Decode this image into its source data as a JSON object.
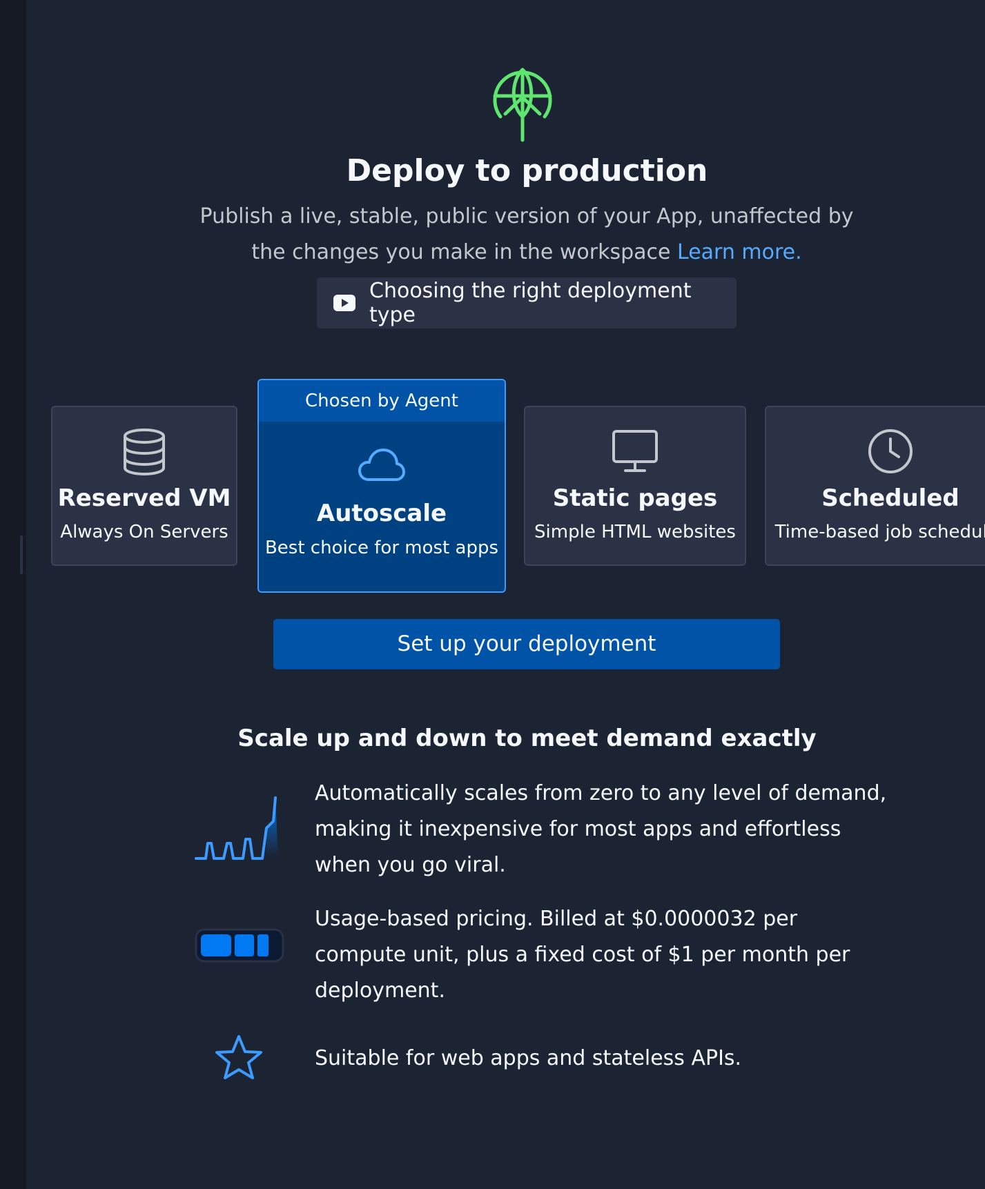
{
  "header": {
    "title": "Deploy to production",
    "subtitle": "Publish a live, stable, public version of your App, unaffected by the changes you make in the workspace",
    "learn_more": "Learn more.",
    "video_label": "Choosing the right deployment type"
  },
  "deployment_types": [
    {
      "name": "Reserved VM",
      "description": "Always On Servers",
      "icon": "database-icon"
    },
    {
      "name": "Autoscale",
      "description": "Best choice for most apps",
      "icon": "cloud-icon",
      "tag": "Chosen by Agent",
      "selected": true
    },
    {
      "name": "Static pages",
      "description": "Simple HTML websites",
      "icon": "monitor-icon"
    },
    {
      "name": "Scheduled",
      "description": "Time-based job scheduler",
      "icon": "clock-icon"
    }
  ],
  "actions": {
    "setup_label": "Set up your deployment"
  },
  "details": {
    "title": "Scale up and down to meet demand exactly",
    "features": [
      {
        "icon": "scaling-graph-icon",
        "text": "Automatically scales from zero to any level of demand, making it inexpensive for most apps and effortless when you go viral."
      },
      {
        "icon": "usage-meter-icon",
        "text": "Usage-based pricing. Billed at $0.0000032 per compute unit, plus a fixed cost of $1 per month per deployment."
      },
      {
        "icon": "star-icon",
        "text": "Suitable for web apps and stateless APIs."
      }
    ]
  },
  "colors": {
    "background": "#1c2333",
    "accent": "#0053a6",
    "link": "#57abff",
    "hero_icon": "#5ee66f"
  }
}
